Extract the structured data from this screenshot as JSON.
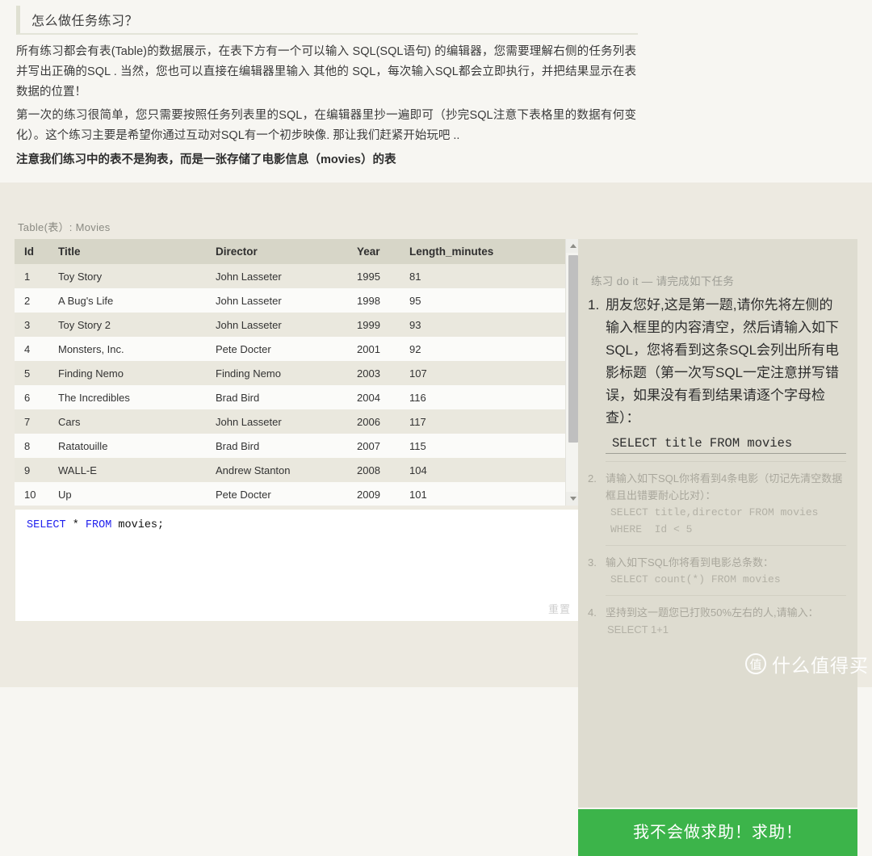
{
  "page": {
    "title": "怎么做任务练习？",
    "paragraphs": [
      "所有练习都会有表(Table)的数据展示，在表下方有一个可以输入 SQL(SQL语句) 的编辑器，您需要理解右侧的任务列表并写出正确的SQL . 当然，您也可以直接在编辑器里输入 其他的 SQL，每次输入SQL都会立即执行，并把结果显示在表数据的位置！",
      "第一次的练习很简单，您只需要按照任务列表里的SQL，在编辑器里抄一遍即可（抄完SQL注意下表格里的数据有何变化）。这个练习主要是希望你通过互动对SQL有一个初步映像. 那让我们赶紧开始玩吧 ..",
      "注意我们练习中的表不是狗表，而是一张存储了电影信息（movies）的表"
    ]
  },
  "table": {
    "caption": "Table(表）: Movies",
    "columns": [
      "Id",
      "Title",
      "Director",
      "Year",
      "Length_minutes"
    ],
    "rows": [
      [
        "1",
        "Toy Story",
        "John Lasseter",
        "1995",
        "81"
      ],
      [
        "2",
        "A Bug's Life",
        "John Lasseter",
        "1998",
        "95"
      ],
      [
        "3",
        "Toy Story 2",
        "John Lasseter",
        "1999",
        "93"
      ],
      [
        "4",
        "Monsters, Inc.",
        "Pete Docter",
        "2001",
        "92"
      ],
      [
        "5",
        "Finding Nemo",
        "Finding Nemo",
        "2003",
        "107"
      ],
      [
        "6",
        "The Incredibles",
        "Brad Bird",
        "2004",
        "116"
      ],
      [
        "7",
        "Cars",
        "John Lasseter",
        "2006",
        "117"
      ],
      [
        "8",
        "Ratatouille",
        "Brad Bird",
        "2007",
        "115"
      ],
      [
        "9",
        "WALL-E",
        "Andrew Stanton",
        "2008",
        "104"
      ],
      [
        "10",
        "Up",
        "Pete Docter",
        "2009",
        "101"
      ]
    ]
  },
  "editor": {
    "sql_keyword_1": "SELECT",
    "sql_rest": " * ",
    "sql_keyword_2": "FROM",
    "sql_tail": " movies;",
    "reset_label": "重置"
  },
  "tasks": {
    "heading": "练习 do it — 请完成如下任务",
    "items": [
      {
        "num": "1.",
        "text": "朋友您好,这是第一题,请你先将左侧的输入框里的内容清空，然后请输入如下SQL，您将看到这条SQL会列出所有电影标题（第一次写SQL一定注意拼写错误，如果没有看到结果请逐个字母检查）：",
        "sql": "SELECT title FROM movies"
      },
      {
        "num": "2.",
        "text": "请输入如下SQL你将看到4条电影（切记先清空数据框且出错要耐心比对）：",
        "sql": "SELECT title,director FROM movies\nWHERE  Id < 5"
      },
      {
        "num": "3.",
        "text": "输入如下SQL你将看到电影总条数：",
        "sql": "SELECT count(*) FROM movies"
      },
      {
        "num": "4.",
        "text": "坚持到这一题您已打败50%左右的人,请输入：",
        "sql_plain": "SELECT 1+1"
      }
    ]
  },
  "help": {
    "label": "我不会做求助！求助！"
  },
  "watermark": {
    "badge": "值",
    "text": "什么值得买"
  },
  "colors": {
    "accent_green": "#3cb44a",
    "page_bg": "#f7f6f2",
    "workspace_bg": "#edeae1",
    "panel_bg": "#dedcd0",
    "table_header_bg": "#d7d6c8",
    "sql_keyword": "#2222ee"
  }
}
